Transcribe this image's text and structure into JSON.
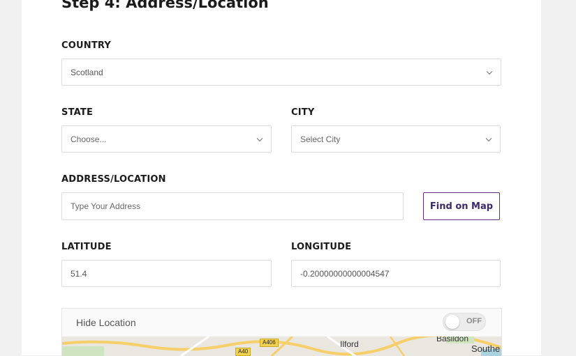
{
  "form": {
    "title": "Step 4: Address/Location",
    "country": {
      "label": "COUNTRY",
      "value": "Scotland"
    },
    "state": {
      "label": "STATE",
      "value": "Choose..."
    },
    "city": {
      "label": "CITY",
      "value": "Select City"
    },
    "address": {
      "label": "ADDRESS/LOCATION",
      "placeholder": "Type Your Address",
      "find_button": "Find on Map"
    },
    "latitude": {
      "label": "LATITUDE",
      "value": "51.4"
    },
    "longitude": {
      "label": "LONGITUDE",
      "value": "-0.20000000000004547"
    }
  },
  "map": {
    "hide_label": "Hide Location",
    "toggle_state": "OFF",
    "places": [
      "Ilford",
      "Basildon",
      "Southe"
    ],
    "roads": [
      "A40",
      "A406"
    ]
  },
  "colors": {
    "accent": "#5b2c83",
    "border": "#dcdcdc"
  }
}
